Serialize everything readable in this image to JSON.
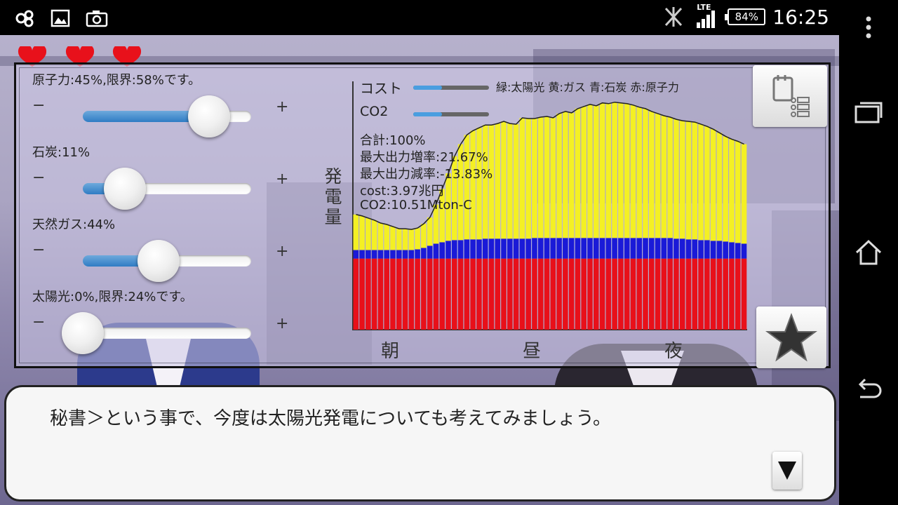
{
  "status_bar": {
    "battery": "84%",
    "network": "LTE",
    "time": "16:25",
    "icons": [
      "app-icon",
      "gallery-icon",
      "camera-icon",
      "vibrate-off-icon",
      "signal-icon",
      "battery-icon"
    ]
  },
  "nav_bar": {
    "icons": [
      "overflow-menu-icon",
      "recents-icon",
      "home-icon",
      "back-icon"
    ]
  },
  "lives": {
    "count": 3,
    "icon": "heart-icon",
    "color": "#e8111b"
  },
  "sliders": [
    {
      "label": "原子力:45%,限界:58%です。",
      "minus": "−",
      "plus": "+",
      "level": 0.75,
      "fill": 0.7
    },
    {
      "label": "石炭:11%",
      "minus": "−",
      "plus": "+",
      "level": 0.25,
      "fill": 0.2
    },
    {
      "label": "天然ガス:44%",
      "minus": "−",
      "plus": "+",
      "level": 0.45,
      "fill": 0.45
    },
    {
      "label": "太陽光:0%,限界:24%です。",
      "minus": "−",
      "plus": "+",
      "level": 0.0,
      "fill": 0.0
    }
  ],
  "legend": {
    "cost_label": "コスト",
    "cost_level": 0.38,
    "co2_label": "CO2",
    "co2_level": 0.38,
    "color_legend": "緑:太陽光 黄:ガス 青:石炭 赤:原子力"
  },
  "stats": {
    "total": "合計:100%",
    "max_increase": "最大出力増率:21.67%",
    "max_decrease": "最大出力減率:-13.83%",
    "cost": "cost:3.97兆円",
    "co2": "CO2:10.51Mton-C"
  },
  "chart_data": {
    "type": "area",
    "ylabel": "発電量",
    "xticks": [
      "朝",
      "昼",
      "夜"
    ],
    "stacked": true,
    "colors": {
      "nuclear": "#e8101a",
      "coal": "#1a1ad8",
      "gas": "#f4f024"
    },
    "ylim": [
      0,
      300
    ],
    "series": [
      {
        "name": "原子力",
        "color": "#e8101a",
        "values": [
          100,
          100,
          100,
          100,
          100,
          100,
          100,
          100,
          100,
          100,
          100,
          100,
          100,
          100,
          100,
          100,
          100,
          100,
          100,
          100,
          100,
          100,
          100,
          100,
          100,
          100,
          100,
          100,
          100,
          100,
          100,
          100,
          100,
          100,
          100,
          100,
          100,
          100,
          100,
          100,
          100,
          100,
          100,
          100,
          100,
          100,
          100,
          100,
          100,
          100,
          100,
          100,
          100,
          100,
          100,
          100,
          100,
          100,
          100,
          100,
          100,
          100,
          100,
          100
        ]
      },
      {
        "name": "石炭",
        "color": "#1a1ad8",
        "values": [
          12,
          12,
          12,
          12,
          12,
          12,
          12,
          12,
          12,
          12,
          13,
          15,
          18,
          21,
          23,
          25,
          26,
          26,
          27,
          27,
          27,
          28,
          28,
          28,
          28,
          28,
          28,
          28,
          28,
          29,
          29,
          29,
          29,
          29,
          29,
          29,
          29,
          29,
          29,
          29,
          29,
          29,
          29,
          29,
          29,
          29,
          29,
          29,
          29,
          29,
          29,
          29,
          28,
          28,
          27,
          27,
          26,
          26,
          25,
          25,
          24,
          23,
          22,
          21
        ]
      },
      {
        "name": "天然ガス",
        "color": "#f4f024",
        "values": [
          50,
          48,
          45,
          42,
          38,
          36,
          33,
          30,
          30,
          29,
          30,
          34,
          40,
          55,
          75,
          95,
          118,
          135,
          147,
          153,
          157,
          160,
          160,
          162,
          165,
          162,
          161,
          170,
          169,
          168,
          170,
          171,
          169,
          175,
          178,
          176,
          182,
          185,
          188,
          186,
          190,
          189,
          191,
          190,
          189,
          187,
          184,
          182,
          178,
          175,
          172,
          170,
          168,
          166,
          166,
          165,
          163,
          160,
          157,
          152,
          148,
          145,
          143,
          140
        ]
      }
    ]
  },
  "side_buttons": {
    "top": "memo-list-icon",
    "bottom": "star-icon"
  },
  "dialogue": {
    "text": "秘書＞という事で、今度は太陽光発電についても考えてみましょう。",
    "next_icon": "triangle-down-icon"
  }
}
